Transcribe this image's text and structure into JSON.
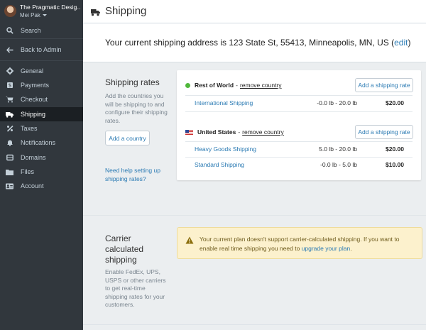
{
  "store": {
    "name": "The Pragmatic Desig…",
    "user": "Mei Pak"
  },
  "nav": {
    "search": "Search",
    "back": "Back to Admin",
    "items": [
      {
        "label": "General",
        "icon": "gear-icon"
      },
      {
        "label": "Payments",
        "icon": "payments-icon"
      },
      {
        "label": "Checkout",
        "icon": "cart-icon"
      },
      {
        "label": "Shipping",
        "icon": "truck-icon"
      },
      {
        "label": "Taxes",
        "icon": "taxes-icon"
      },
      {
        "label": "Notifications",
        "icon": "bell-icon"
      },
      {
        "label": "Domains",
        "icon": "globe-icon"
      },
      {
        "label": "Files",
        "icon": "folder-icon"
      },
      {
        "label": "Account",
        "icon": "account-icon"
      }
    ]
  },
  "header": {
    "title": "Shipping"
  },
  "address": {
    "prefix": "Your current shipping address is 123 State St, 55413, Minneapolis, MN, US (",
    "edit": "edit",
    "suffix": ")"
  },
  "rates": {
    "title": "Shipping rates",
    "desc": "Add the countries you will be shipping to and configure their shipping rates.",
    "add_country": "Add a country",
    "help": "Need help setting up shipping rates?",
    "remove_label": "remove country",
    "add_rate": "Add a shipping rate",
    "groups": [
      {
        "name": "Rest of World",
        "rows": [
          {
            "name": "International Shipping",
            "range": "-0.0 lb - 20.0 lb",
            "price": "$20.00"
          }
        ]
      },
      {
        "name": "United States",
        "rows": [
          {
            "name": "Heavy Goods Shipping",
            "range": "5.0 lb - 20.0 lb",
            "price": "$20.00"
          },
          {
            "name": "Standard Shipping",
            "range": "-0.0 lb - 5.0 lb",
            "price": "$10.00"
          }
        ]
      }
    ]
  },
  "carrier": {
    "title_l1": "Carrier",
    "title_l2": "calculated",
    "title_l3": "shipping",
    "desc": "Enable FedEx, UPS, USPS or other carriers to get real-time shipping rates for your customers.",
    "warning": "Your current plan doesn't support carrier-calculated shipping. If you want to enable real time shipping you need to ",
    "warning_link": "upgrade your plan",
    "warning_end": "."
  },
  "colors": {
    "sidebar": "#31373d",
    "link": "#2a7ab3",
    "warning_bg": "#fcf1cd"
  }
}
